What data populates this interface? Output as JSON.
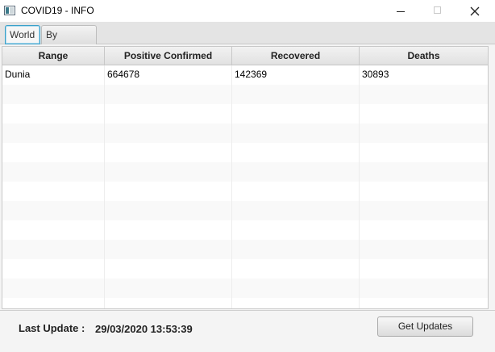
{
  "window": {
    "title": "COVID19 - INFO",
    "app_icon": "app-window-icon",
    "controls": [
      "minimize-icon",
      "maximize-icon",
      "close-icon"
    ]
  },
  "tabs": [
    {
      "label": "World",
      "selected": true
    },
    {
      "label": "By Country",
      "selected": false
    }
  ],
  "table": {
    "columns": [
      "Range",
      "Positive Confirmed",
      "Recovered",
      "Deaths"
    ],
    "rows": [
      [
        "Dunia",
        "664678",
        "142369",
        "30893"
      ]
    ]
  },
  "footer": {
    "last_update_label": "Last Update :",
    "last_update_value": "29/03/2020 13:53:39",
    "button_label": "Get Updates"
  },
  "colors": {
    "tab_focus_border": "#3aa0c8",
    "window_background": "#f4f4f4"
  }
}
